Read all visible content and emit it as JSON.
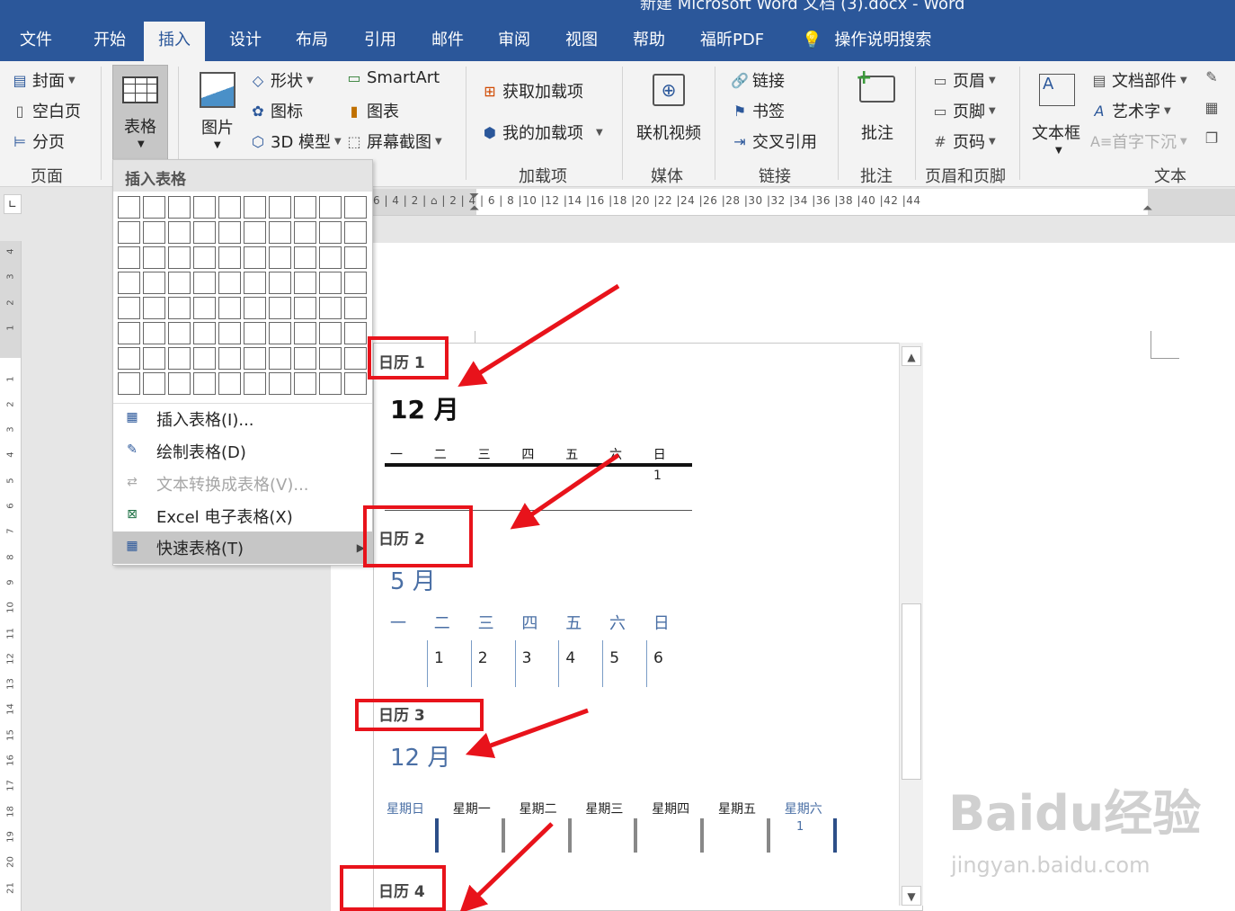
{
  "titlebar": {
    "text": "新建 Microsoft Word 文档 (3).docx - Word"
  },
  "tabs": [
    {
      "label": "文件"
    },
    {
      "label": "开始"
    },
    {
      "label": "插入"
    },
    {
      "label": "设计"
    },
    {
      "label": "布局"
    },
    {
      "label": "引用"
    },
    {
      "label": "邮件"
    },
    {
      "label": "审阅"
    },
    {
      "label": "视图"
    },
    {
      "label": "帮助"
    },
    {
      "label": "福昕PDF"
    },
    {
      "label": "操作说明搜索"
    }
  ],
  "ribbon": {
    "pages": {
      "cover": "封面",
      "blank": "空白页",
      "break": "分页",
      "group": "页面"
    },
    "table": {
      "label": "表格"
    },
    "illus": {
      "picture": "图片",
      "shapes": "形状",
      "icons": "图标",
      "model3d": "3D 模型",
      "smartart": "SmartArt",
      "chart": "图表",
      "screenshot": "屏幕截图"
    },
    "addins": {
      "get": "获取加载项",
      "mine": "我的加载项",
      "group": "加载项"
    },
    "media": {
      "video": "联机视频",
      "group": "媒体"
    },
    "links": {
      "link": "链接",
      "bookmark": "书签",
      "crossref": "交叉引用",
      "group": "链接"
    },
    "comments": {
      "comment": "批注",
      "group": "批注"
    },
    "headerfooter": {
      "header": "页眉",
      "footer": "页脚",
      "pagenum": "页码",
      "group": "页眉和页脚"
    },
    "text": {
      "textbox": "文本框",
      "parts": "文档部件",
      "wordart": "艺术字",
      "dropcap": "首字下沉",
      "group": "文本"
    }
  },
  "ruler": {
    "ticks": "6 | 4 | 2 |  ⌂  | 2 | 4 | 6 | 8 |10 |12 |14 |16 |18 |20 |22 |24 |26 |28 |30 |32 |34 |36 |38 |40 |42 |44"
  },
  "vruler": {
    "ticks": [
      "4",
      "3",
      "2",
      "1",
      "",
      "1",
      "2",
      "3",
      "4",
      "5",
      "6",
      "7",
      "8",
      "9",
      "10",
      "11",
      "12",
      "13",
      "14",
      "15",
      "16",
      "17",
      "18",
      "19",
      "20",
      "21"
    ]
  },
  "dropdown": {
    "header": "插入表格",
    "items": [
      {
        "label": "插入表格(I)...",
        "icon": "table-icon"
      },
      {
        "label": "绘制表格(D)",
        "icon": "pencil-table-icon"
      },
      {
        "label": "文本转换成表格(V)...",
        "icon": "convert-table-icon",
        "disabled": true
      },
      {
        "label": "Excel 电子表格(X)",
        "icon": "excel-icon"
      },
      {
        "label": "快速表格(T)",
        "icon": "quick-table-icon",
        "highlighted": true
      }
    ]
  },
  "gallery": {
    "cal1": {
      "name": "日历 1",
      "month": "12  月",
      "days": [
        "一",
        "二",
        "三",
        "四",
        "五",
        "六",
        "日"
      ],
      "cells": [
        "1"
      ]
    },
    "cal2": {
      "name": "日历 2",
      "month": "5  月",
      "days": [
        "一",
        "二",
        "三",
        "四",
        "五",
        "六",
        "日"
      ],
      "cells": [
        "1",
        "2",
        "3",
        "4",
        "5",
        "6"
      ]
    },
    "cal3": {
      "name": "日历 3",
      "month": "12  月",
      "days": [
        "星期日",
        "星期一",
        "星期二",
        "星期三",
        "星期四",
        "星期五",
        "星期六"
      ],
      "cells": [
        "1"
      ]
    },
    "cal4": {
      "name": "日历 4"
    }
  },
  "watermark": {
    "main": "Baidu经验",
    "sub": "jingyan.baidu.com"
  },
  "colors": {
    "brand": "#2b579a",
    "annotation": "#e8131b",
    "calendarBlue": "#4a6fa5"
  }
}
